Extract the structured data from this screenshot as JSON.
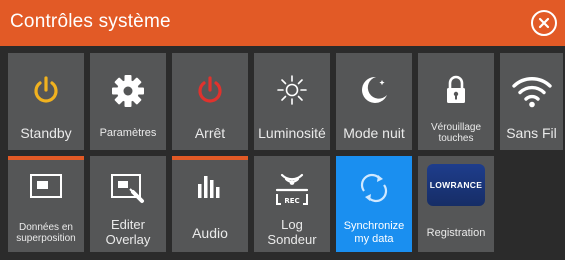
{
  "window": {
    "title": "Contrôles système",
    "accent_color": "#e25a26",
    "tile_color": "#555657",
    "selected_color": "#1a8ff0"
  },
  "tiles": [
    {
      "label": "Standby",
      "icon": "power-icon",
      "icon_color": "#f1b21f"
    },
    {
      "label": "Paramètres",
      "icon": "gear-icon"
    },
    {
      "label": "Arrêt",
      "icon": "power-icon",
      "icon_color": "#e0322d"
    },
    {
      "label": "Luminosité",
      "icon": "brightness-icon"
    },
    {
      "label": "Mode nuit",
      "icon": "moon-icon"
    },
    {
      "label": "Vérouillage touches",
      "line1": "Vérouillage",
      "line2": "touches",
      "icon": "lock-icon"
    },
    {
      "label": "Sans Fil",
      "icon": "wifi-icon"
    },
    {
      "label": "Données en superposition",
      "line1": "Données en",
      "line2": "superposition",
      "icon": "overlay-icon",
      "active_bar": true
    },
    {
      "label": "Editer Overlay",
      "line1": "Editer",
      "line2": "Overlay",
      "icon": "edit-overlay-icon"
    },
    {
      "label": "Audio",
      "icon": "audio-bars-icon",
      "active_bar": true
    },
    {
      "label": "Log Sondeur",
      "line1": "Log",
      "line2": "Sondeur",
      "icon": "sonar-record-icon",
      "icon_badge": "REC"
    },
    {
      "label": "Synchronize my data",
      "line1": "Synchronize",
      "line2": "my data",
      "icon": "sync-icon",
      "selected": true
    },
    {
      "label": "Registration",
      "icon": "lowrance-logo",
      "logo_text": "LOWRANCE"
    }
  ]
}
